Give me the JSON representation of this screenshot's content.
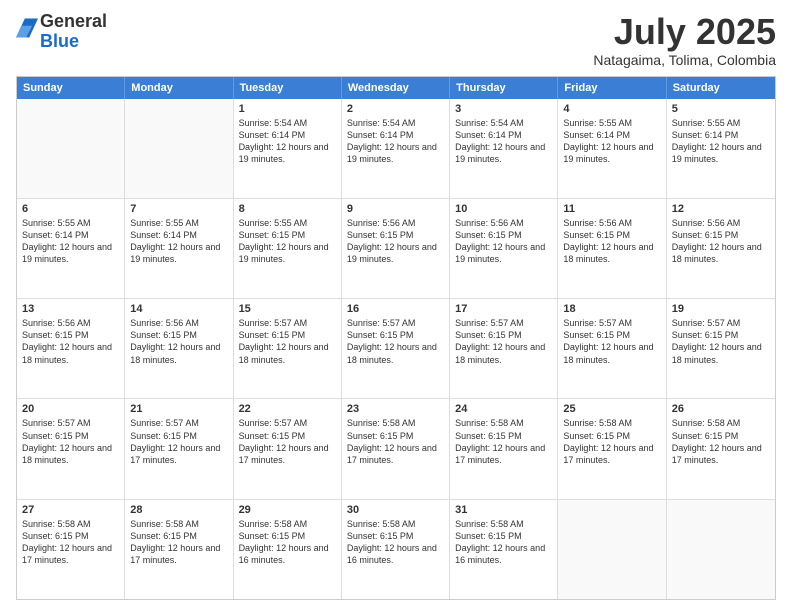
{
  "header": {
    "logo_general": "General",
    "logo_blue": "Blue",
    "month_title": "July 2025",
    "subtitle": "Natagaima, Tolima, Colombia"
  },
  "weekdays": [
    "Sunday",
    "Monday",
    "Tuesday",
    "Wednesday",
    "Thursday",
    "Friday",
    "Saturday"
  ],
  "rows": [
    [
      {
        "day": "",
        "text": ""
      },
      {
        "day": "",
        "text": ""
      },
      {
        "day": "1",
        "text": "Sunrise: 5:54 AM\nSunset: 6:14 PM\nDaylight: 12 hours and 19 minutes."
      },
      {
        "day": "2",
        "text": "Sunrise: 5:54 AM\nSunset: 6:14 PM\nDaylight: 12 hours and 19 minutes."
      },
      {
        "day": "3",
        "text": "Sunrise: 5:54 AM\nSunset: 6:14 PM\nDaylight: 12 hours and 19 minutes."
      },
      {
        "day": "4",
        "text": "Sunrise: 5:55 AM\nSunset: 6:14 PM\nDaylight: 12 hours and 19 minutes."
      },
      {
        "day": "5",
        "text": "Sunrise: 5:55 AM\nSunset: 6:14 PM\nDaylight: 12 hours and 19 minutes."
      }
    ],
    [
      {
        "day": "6",
        "text": "Sunrise: 5:55 AM\nSunset: 6:14 PM\nDaylight: 12 hours and 19 minutes."
      },
      {
        "day": "7",
        "text": "Sunrise: 5:55 AM\nSunset: 6:14 PM\nDaylight: 12 hours and 19 minutes."
      },
      {
        "day": "8",
        "text": "Sunrise: 5:55 AM\nSunset: 6:15 PM\nDaylight: 12 hours and 19 minutes."
      },
      {
        "day": "9",
        "text": "Sunrise: 5:56 AM\nSunset: 6:15 PM\nDaylight: 12 hours and 19 minutes."
      },
      {
        "day": "10",
        "text": "Sunrise: 5:56 AM\nSunset: 6:15 PM\nDaylight: 12 hours and 19 minutes."
      },
      {
        "day": "11",
        "text": "Sunrise: 5:56 AM\nSunset: 6:15 PM\nDaylight: 12 hours and 18 minutes."
      },
      {
        "day": "12",
        "text": "Sunrise: 5:56 AM\nSunset: 6:15 PM\nDaylight: 12 hours and 18 minutes."
      }
    ],
    [
      {
        "day": "13",
        "text": "Sunrise: 5:56 AM\nSunset: 6:15 PM\nDaylight: 12 hours and 18 minutes."
      },
      {
        "day": "14",
        "text": "Sunrise: 5:56 AM\nSunset: 6:15 PM\nDaylight: 12 hours and 18 minutes."
      },
      {
        "day": "15",
        "text": "Sunrise: 5:57 AM\nSunset: 6:15 PM\nDaylight: 12 hours and 18 minutes."
      },
      {
        "day": "16",
        "text": "Sunrise: 5:57 AM\nSunset: 6:15 PM\nDaylight: 12 hours and 18 minutes."
      },
      {
        "day": "17",
        "text": "Sunrise: 5:57 AM\nSunset: 6:15 PM\nDaylight: 12 hours and 18 minutes."
      },
      {
        "day": "18",
        "text": "Sunrise: 5:57 AM\nSunset: 6:15 PM\nDaylight: 12 hours and 18 minutes."
      },
      {
        "day": "19",
        "text": "Sunrise: 5:57 AM\nSunset: 6:15 PM\nDaylight: 12 hours and 18 minutes."
      }
    ],
    [
      {
        "day": "20",
        "text": "Sunrise: 5:57 AM\nSunset: 6:15 PM\nDaylight: 12 hours and 18 minutes."
      },
      {
        "day": "21",
        "text": "Sunrise: 5:57 AM\nSunset: 6:15 PM\nDaylight: 12 hours and 17 minutes."
      },
      {
        "day": "22",
        "text": "Sunrise: 5:57 AM\nSunset: 6:15 PM\nDaylight: 12 hours and 17 minutes."
      },
      {
        "day": "23",
        "text": "Sunrise: 5:58 AM\nSunset: 6:15 PM\nDaylight: 12 hours and 17 minutes."
      },
      {
        "day": "24",
        "text": "Sunrise: 5:58 AM\nSunset: 6:15 PM\nDaylight: 12 hours and 17 minutes."
      },
      {
        "day": "25",
        "text": "Sunrise: 5:58 AM\nSunset: 6:15 PM\nDaylight: 12 hours and 17 minutes."
      },
      {
        "day": "26",
        "text": "Sunrise: 5:58 AM\nSunset: 6:15 PM\nDaylight: 12 hours and 17 minutes."
      }
    ],
    [
      {
        "day": "27",
        "text": "Sunrise: 5:58 AM\nSunset: 6:15 PM\nDaylight: 12 hours and 17 minutes."
      },
      {
        "day": "28",
        "text": "Sunrise: 5:58 AM\nSunset: 6:15 PM\nDaylight: 12 hours and 17 minutes."
      },
      {
        "day": "29",
        "text": "Sunrise: 5:58 AM\nSunset: 6:15 PM\nDaylight: 12 hours and 16 minutes."
      },
      {
        "day": "30",
        "text": "Sunrise: 5:58 AM\nSunset: 6:15 PM\nDaylight: 12 hours and 16 minutes."
      },
      {
        "day": "31",
        "text": "Sunrise: 5:58 AM\nSunset: 6:15 PM\nDaylight: 12 hours and 16 minutes."
      },
      {
        "day": "",
        "text": ""
      },
      {
        "day": "",
        "text": ""
      }
    ]
  ]
}
